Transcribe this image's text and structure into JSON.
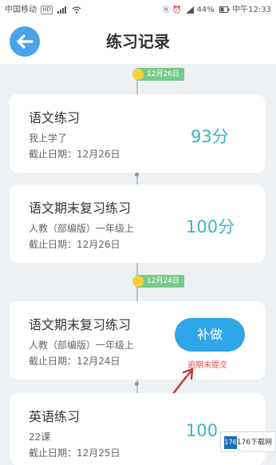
{
  "statusbar": {
    "carrier": "中国移动",
    "network_badge": "HD",
    "battery": "44%",
    "time_label": "中午12:33"
  },
  "header": {
    "title": "练习记录"
  },
  "timeline": {
    "dates": [
      "12月26日",
      "12月24日"
    ]
  },
  "records": [
    {
      "title": "语文练习",
      "subtitle": "我上学了",
      "deadline": "截止日期：12月26日",
      "score": "93分"
    },
    {
      "title": "语文期末复习练习",
      "subtitle": "人教（部编版）一年级上",
      "deadline": "截止日期：12月26日",
      "score": "100分"
    },
    {
      "title": "语文期末复习练习",
      "subtitle": "人教（部编版）一年级上",
      "deadline": "截止日期：12月24日",
      "action": "补做",
      "status": "逾期未提交"
    },
    {
      "title": "英语练习",
      "subtitle": "22课",
      "deadline": "截止日期：12月25日",
      "score": "100"
    }
  ],
  "watermark": {
    "logo": "176",
    "text": "176下载网"
  },
  "colors": {
    "accent": "#2ea6e8",
    "score": "#3ab4c7",
    "date_pill": "#79c98a",
    "overdue": "#e04a4a"
  }
}
